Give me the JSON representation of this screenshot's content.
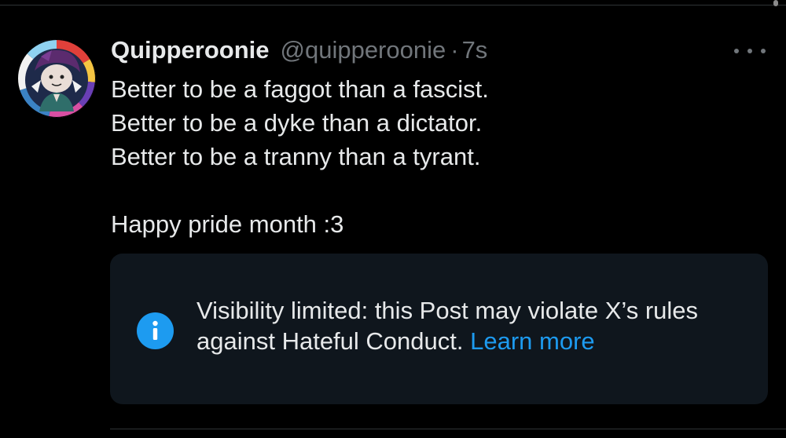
{
  "post": {
    "display_name": "Quipperoonie",
    "handle": "@quipperoonie",
    "separator": "·",
    "timestamp": "7s",
    "lines": [
      "Better to be a faggot than a fascist.",
      "Better to be a dyke than a dictator.",
      "Better to be a tranny than a tyrant."
    ],
    "closing_line": "Happy pride month :3"
  },
  "notice": {
    "text": "Visibility limited: this Post may violate X’s rules against Hateful Conduct.",
    "link_label": "Learn more",
    "icon": "info-icon"
  },
  "icons": {
    "more": "more-horizontal-icon"
  },
  "colors": {
    "background": "#000000",
    "text_primary": "#e7e9ea",
    "text_secondary": "#71767b",
    "accent": "#1d9bf0",
    "card_background": "#0f161d"
  }
}
